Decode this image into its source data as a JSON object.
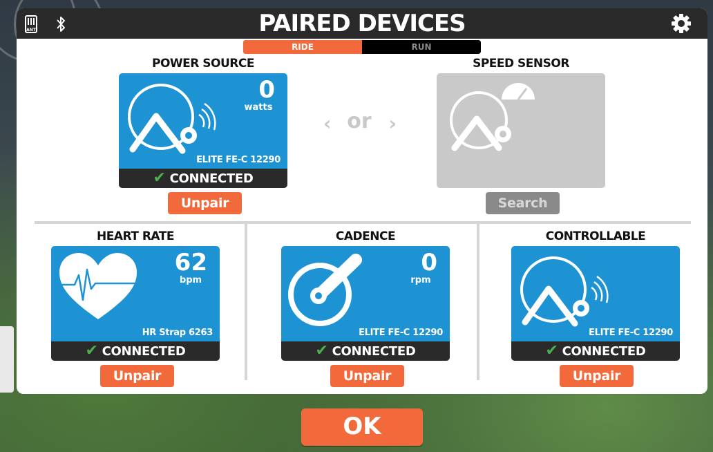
{
  "header": {
    "title": "PAIRED DEVICES",
    "ant_label": "ANT",
    "ant_icon": "ant-plus-icon",
    "bluetooth_icon": "bluetooth-icon",
    "settings_icon": "gear-icon"
  },
  "tabs": [
    {
      "label": "RIDE",
      "active": true
    },
    {
      "label": "RUN",
      "active": false
    }
  ],
  "power_source": {
    "title": "POWER SOURCE",
    "value": "0",
    "unit": "watts",
    "device_name": "ELITE FE-C 12290",
    "status": "CONNECTED",
    "action": "Unpair",
    "icon": "smart-trainer-icon"
  },
  "or_label": "or",
  "speed_sensor": {
    "title": "SPEED SENSOR",
    "action": "Search",
    "icon": "speed-trainer-icon"
  },
  "heart_rate": {
    "title": "HEART RATE",
    "value": "62",
    "unit": "bpm",
    "device_name": "HR Strap 6263",
    "status": "CONNECTED",
    "action": "Unpair",
    "icon": "heart-icon"
  },
  "cadence": {
    "title": "CADENCE",
    "value": "0",
    "unit": "rpm",
    "device_name": "ELITE FE-C 12290",
    "status": "CONNECTED",
    "action": "Unpair",
    "icon": "crank-icon"
  },
  "controllable": {
    "title": "CONTROLLABLE",
    "device_name": "ELITE FE-C 12290",
    "status": "CONNECTED",
    "action": "Unpair",
    "icon": "smart-trainer-icon"
  },
  "ok_label": "OK",
  "colors": {
    "accent": "#f26a3b",
    "card_blue": "#1e93d3",
    "connected_green": "#4cb050",
    "header_dark": "#2a2a2a"
  }
}
